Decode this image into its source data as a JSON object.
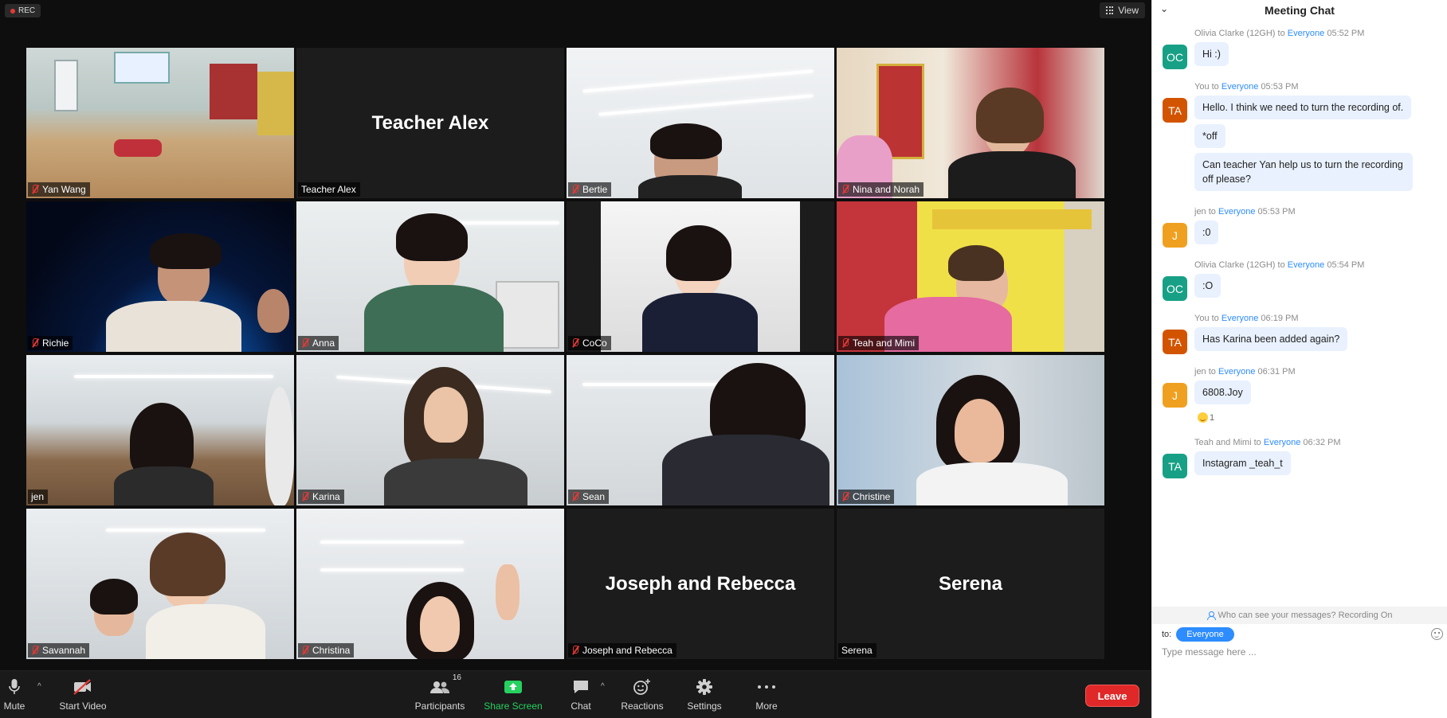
{
  "recording": {
    "label": "REC"
  },
  "view_button": {
    "label": "View"
  },
  "tiles": [
    {
      "name": "Yan Wang",
      "muted": true,
      "video": true,
      "scene": "classroom"
    },
    {
      "name": "Teacher Alex",
      "muted": false,
      "video": false
    },
    {
      "name": "Bertie",
      "muted": true,
      "video": true,
      "scene": "bertie"
    },
    {
      "name": "Nina and Norah",
      "muted": true,
      "video": true,
      "scene": "nina"
    },
    {
      "name": "Richie",
      "muted": true,
      "video": true,
      "scene": "space"
    },
    {
      "name": "Anna",
      "muted": true,
      "video": true,
      "scene": "anna"
    },
    {
      "name": "CoCo",
      "muted": true,
      "video": true,
      "scene": "coco"
    },
    {
      "name": "Teah and Mimi",
      "muted": true,
      "video": true,
      "scene": "teah"
    },
    {
      "name": "jen",
      "muted": false,
      "video": true,
      "scene": "jen",
      "active": true
    },
    {
      "name": "Karina",
      "muted": true,
      "video": true,
      "scene": "karina"
    },
    {
      "name": "Sean",
      "muted": true,
      "video": true,
      "scene": "sean"
    },
    {
      "name": "Christine",
      "muted": true,
      "video": true,
      "scene": "christine"
    },
    {
      "name": "Savannah",
      "muted": true,
      "video": true,
      "scene": "savannah"
    },
    {
      "name": "Christina",
      "muted": true,
      "video": true,
      "scene": "christina"
    },
    {
      "name": "Joseph and Rebecca",
      "muted": true,
      "video": false
    },
    {
      "name": "Serena",
      "muted": false,
      "video": false
    }
  ],
  "toolbar": {
    "mute": "Mute",
    "start_video": "Start Video",
    "participants": "Participants",
    "participants_count": "16",
    "share_screen": "Share Screen",
    "chat": "Chat",
    "reactions": "Reactions",
    "settings": "Settings",
    "more": "More",
    "leave": "Leave"
  },
  "chat": {
    "title": "Meeting Chat",
    "messages": [
      {
        "sender": "Olivia Clarke (12GH)",
        "to_label": "to",
        "recipient": "Everyone",
        "time": "05:52 PM",
        "initials": "OC",
        "avatar_color": "#17a085",
        "texts": [
          "Hi :)"
        ]
      },
      {
        "sender": "You",
        "to_label": "to",
        "recipient": "Everyone",
        "time": "05:53 PM",
        "initials": "TA",
        "avatar_color": "#d35400",
        "texts": [
          "Hello. I think we need to turn the recording of.",
          "*off",
          "Can teacher Yan help us to turn the recording off please?"
        ]
      },
      {
        "sender": "jen",
        "to_label": "to",
        "recipient": "Everyone",
        "time": "05:53 PM",
        "initials": "J",
        "avatar_color": "#f0a020",
        "texts": [
          ":0"
        ]
      },
      {
        "sender": "Olivia Clarke (12GH)",
        "to_label": "to",
        "recipient": "Everyone",
        "time": "05:54 PM",
        "initials": "OC",
        "avatar_color": "#17a085",
        "texts": [
          ":O"
        ]
      },
      {
        "sender": "You",
        "to_label": "to",
        "recipient": "Everyone",
        "time": "06:19 PM",
        "initials": "TA",
        "avatar_color": "#d35400",
        "texts": [
          "Has Karina been added again?"
        ]
      },
      {
        "sender": "jen",
        "to_label": "to",
        "recipient": "Everyone",
        "time": "06:31 PM",
        "initials": "J",
        "avatar_color": "#f0a020",
        "texts": [
          "6808.Joy"
        ],
        "reaction_count": "1"
      },
      {
        "sender": "Teah and Mimi",
        "to_label": "to",
        "recipient": "Everyone",
        "time": "06:32 PM",
        "initials": "TA",
        "avatar_color": "#17a085",
        "texts": [
          "Instagram _teah_t"
        ]
      }
    ],
    "privacy_notice": "Who can see your messages? Recording On",
    "to_label": "to:",
    "recipient_pill": "Everyone",
    "input_placeholder": "Type message here ..."
  }
}
